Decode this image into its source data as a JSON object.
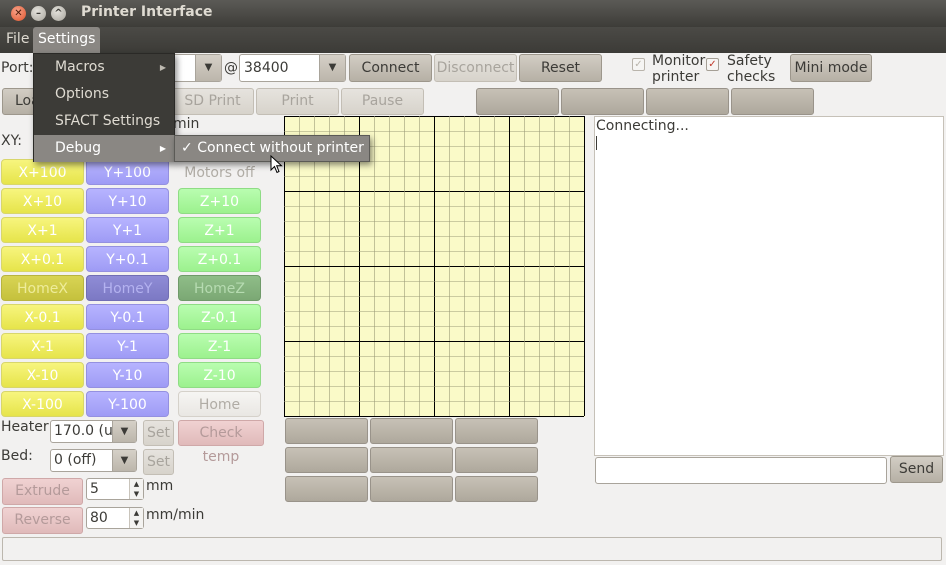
{
  "window": {
    "title": "Printer Interface"
  },
  "menubar": {
    "file": "File",
    "settings": "Settings"
  },
  "settings_menu": {
    "items": [
      {
        "label": "Macros",
        "has_submenu": true
      },
      {
        "label": "Options",
        "has_submenu": false
      },
      {
        "label": "SFACT Settings",
        "has_submenu": false
      },
      {
        "label": "Debug",
        "has_submenu": true
      }
    ],
    "debug_submenu": {
      "label": "Connect without printer",
      "checked": true,
      "check_glyph": "✓"
    }
  },
  "connection": {
    "port_label": "Port:",
    "at_label": "@",
    "baud_value": "38400",
    "connect": "Connect",
    "disconnect": "Disconnect",
    "reset": "Reset",
    "monitor_label_1": "Monitor",
    "monitor_label_2": "printer",
    "safety_label_1": "Safety",
    "safety_label_2": "checks",
    "mini_mode": "Mini mode"
  },
  "toolbar2": {
    "load_partial": "Loa",
    "sd_print": "SD Print",
    "print": "Print",
    "pause": "Pause"
  },
  "movement": {
    "xy_label": "XY:",
    "speed_unit_partial": "min",
    "motors_off": "Motors off",
    "rows": [
      {
        "x": "X+100",
        "y": "Y+100"
      },
      {
        "x": "X+10",
        "y": "Y+10",
        "z": "Z+10"
      },
      {
        "x": "X+1",
        "y": "Y+1",
        "z": "Z+1"
      },
      {
        "x": "X+0.1",
        "y": "Y+0.1",
        "z": "Z+0.1"
      },
      {
        "x": "HomeX",
        "y": "HomeY",
        "z": "HomeZ"
      },
      {
        "x": "X-0.1",
        "y": "Y-0.1",
        "z": "Z-0.1"
      },
      {
        "x": "X-1",
        "y": "Y-1",
        "z": "Z-1"
      },
      {
        "x": "X-10",
        "y": "Y-10",
        "z": "Z-10"
      },
      {
        "x": "X-100",
        "y": "Y-100",
        "z": "Home"
      }
    ]
  },
  "temperature": {
    "heater_label": "Heater:",
    "heater_value": "170.0 (u",
    "bed_label": "Bed:",
    "bed_value": "0 (off)",
    "set": "Set",
    "check_temp": "Check temp"
  },
  "extrusion": {
    "extrude": "Extrude",
    "extrude_value": "5",
    "extrude_unit": "mm",
    "reverse": "Reverse",
    "reverse_value": "80",
    "reverse_unit": "mm/min"
  },
  "console": {
    "text": "Connecting...",
    "send": "Send",
    "input_value": ""
  },
  "colors": {
    "grid_bg": "#fafac8",
    "grid_minor": "#9c9c78",
    "grid_major": "#000000",
    "menu_dark": "#3c3b37",
    "menu_highlight": "#8a8783"
  },
  "icons": {
    "close": "close-icon",
    "minimize": "minimize-icon",
    "maximize": "maximize-icon",
    "cursor": "mouse-cursor-icon"
  }
}
